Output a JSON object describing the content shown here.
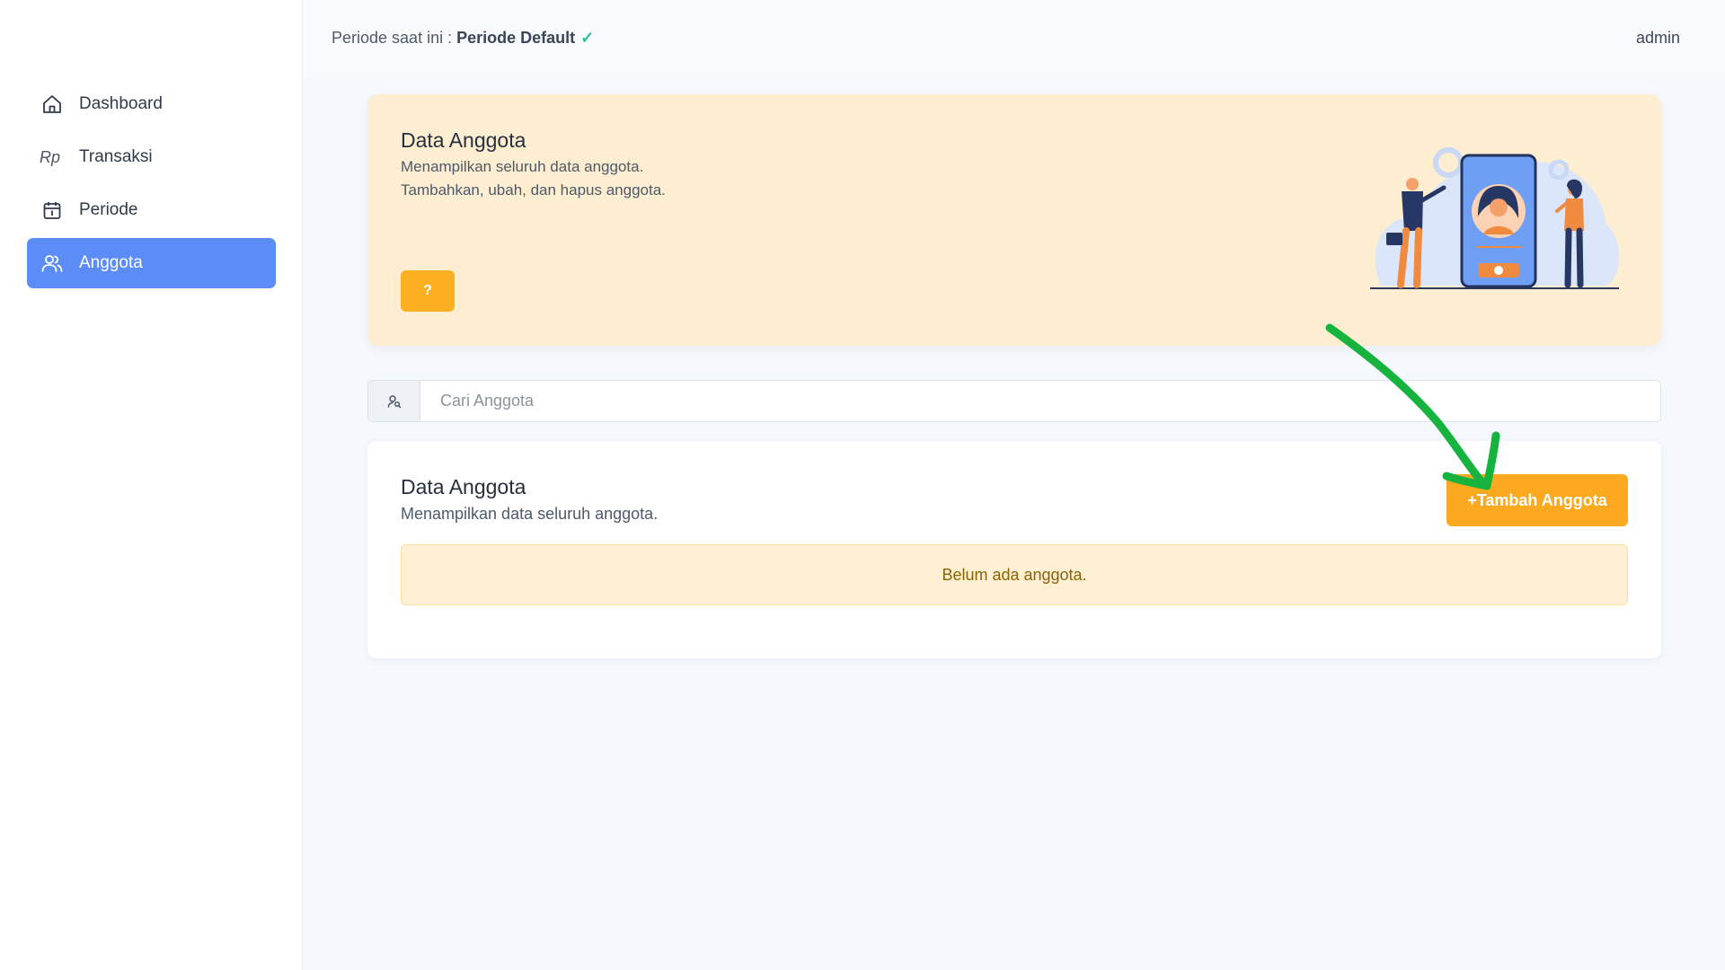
{
  "sidebar": {
    "items": [
      {
        "label": "Dashboard",
        "icon": "home-icon"
      },
      {
        "label": "Transaksi",
        "icon_text": "Rp"
      },
      {
        "label": "Periode",
        "icon": "calendar-icon"
      },
      {
        "label": "Anggota",
        "icon": "users-icon",
        "active": true
      }
    ]
  },
  "topbar": {
    "period_prefix": "Periode saat ini : ",
    "period_name": "Periode Default",
    "period_check": "✓",
    "user": "admin"
  },
  "hero": {
    "title": "Data Anggota",
    "subtitle_1": "Menampilkan seluruh data anggota.",
    "subtitle_2": "Tambahkan, ubah, dan hapus anggota.",
    "help_label": "?"
  },
  "search": {
    "placeholder": "Cari Anggota",
    "value": ""
  },
  "card": {
    "title": "Data Anggota",
    "subtitle": "Menampilkan data seluruh anggota.",
    "add_label": "+Tambah Anggota",
    "empty_text": "Belum ada anggota."
  },
  "colors": {
    "accent_blue": "#5c8cf5",
    "accent_orange": "#fbaa1f",
    "hero_bg": "#feeed1",
    "annotation_green": "#16b33e"
  }
}
